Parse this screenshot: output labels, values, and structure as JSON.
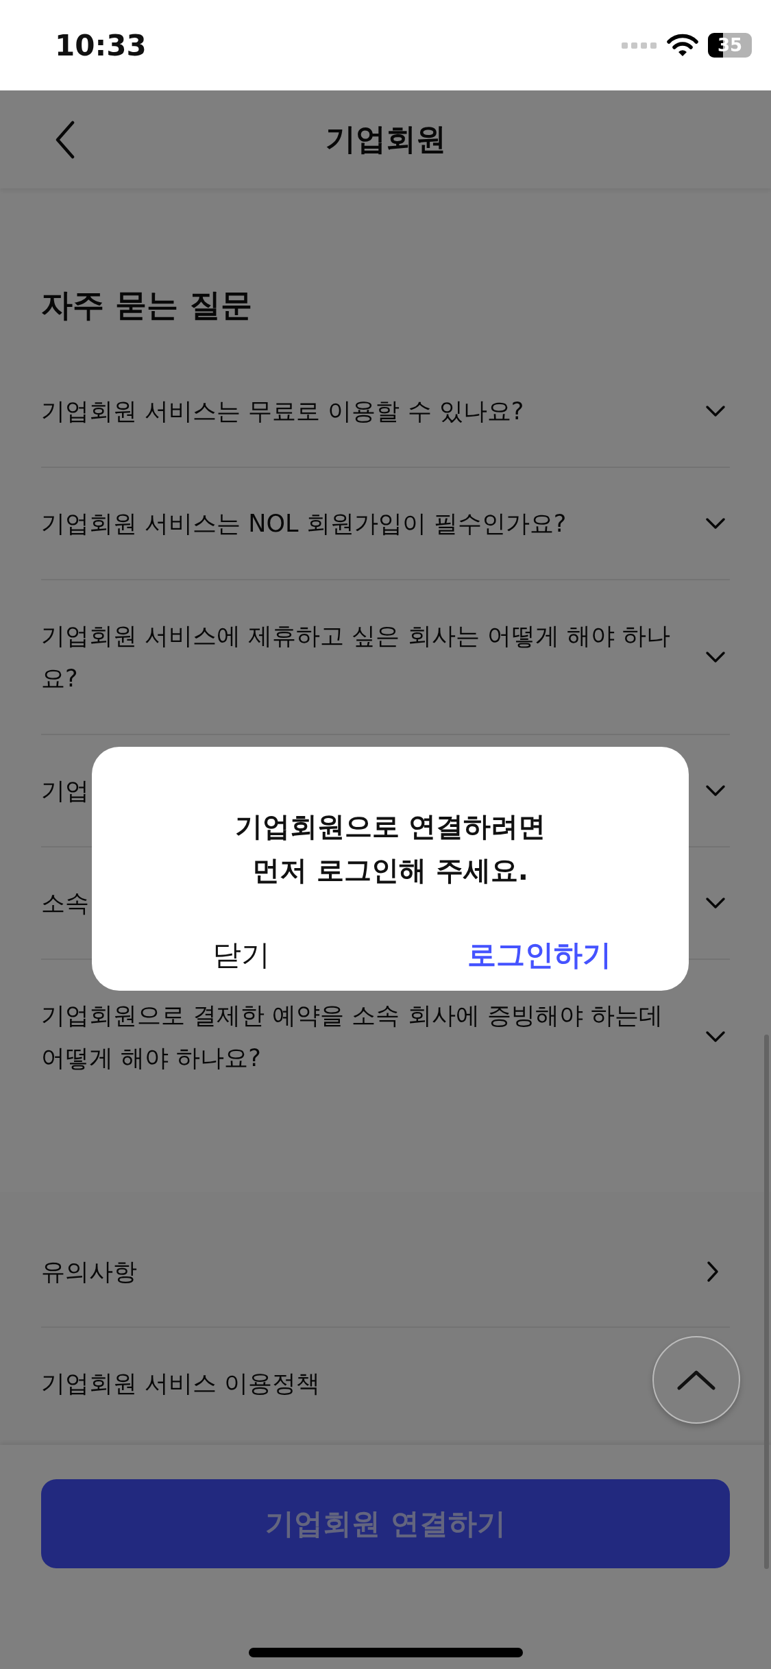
{
  "status_bar": {
    "time": "10:33",
    "battery": "35"
  },
  "header": {
    "title": "기업회원"
  },
  "faq": {
    "title": "자주 묻는 질문",
    "items": [
      {
        "question": "기업회원 서비스는 무료로 이용할 수 있나요?",
        "expanded": false
      },
      {
        "question": "기업회원 서비스는 NOL 회원가입이 필수인가요?",
        "expanded": false
      },
      {
        "question": "기업회원 서비스에 제휴하고 싶은 회사는 어떻게 해야 하나요?",
        "expanded": false
      },
      {
        "question": "기업",
        "expanded": false
      },
      {
        "question": "소속",
        "expanded": false
      },
      {
        "question": "기업회원으로 결제한 예약을 소속 회사에 증빙해야 하는데 어떻게 해야 하나요?",
        "expanded": false
      }
    ]
  },
  "links": [
    {
      "label": "유의사항"
    },
    {
      "label": "기업회원 서비스 이용정책"
    }
  ],
  "cta": {
    "label": "기업회원 연결하기"
  },
  "dialog": {
    "message": [
      "기업회원으로 연결하려면",
      "먼저 로그인해 주세요."
    ],
    "buttons": [
      {
        "label": "닫기",
        "kind": "secondary"
      },
      {
        "label": "로그인하기",
        "kind": "primary"
      }
    ]
  }
}
